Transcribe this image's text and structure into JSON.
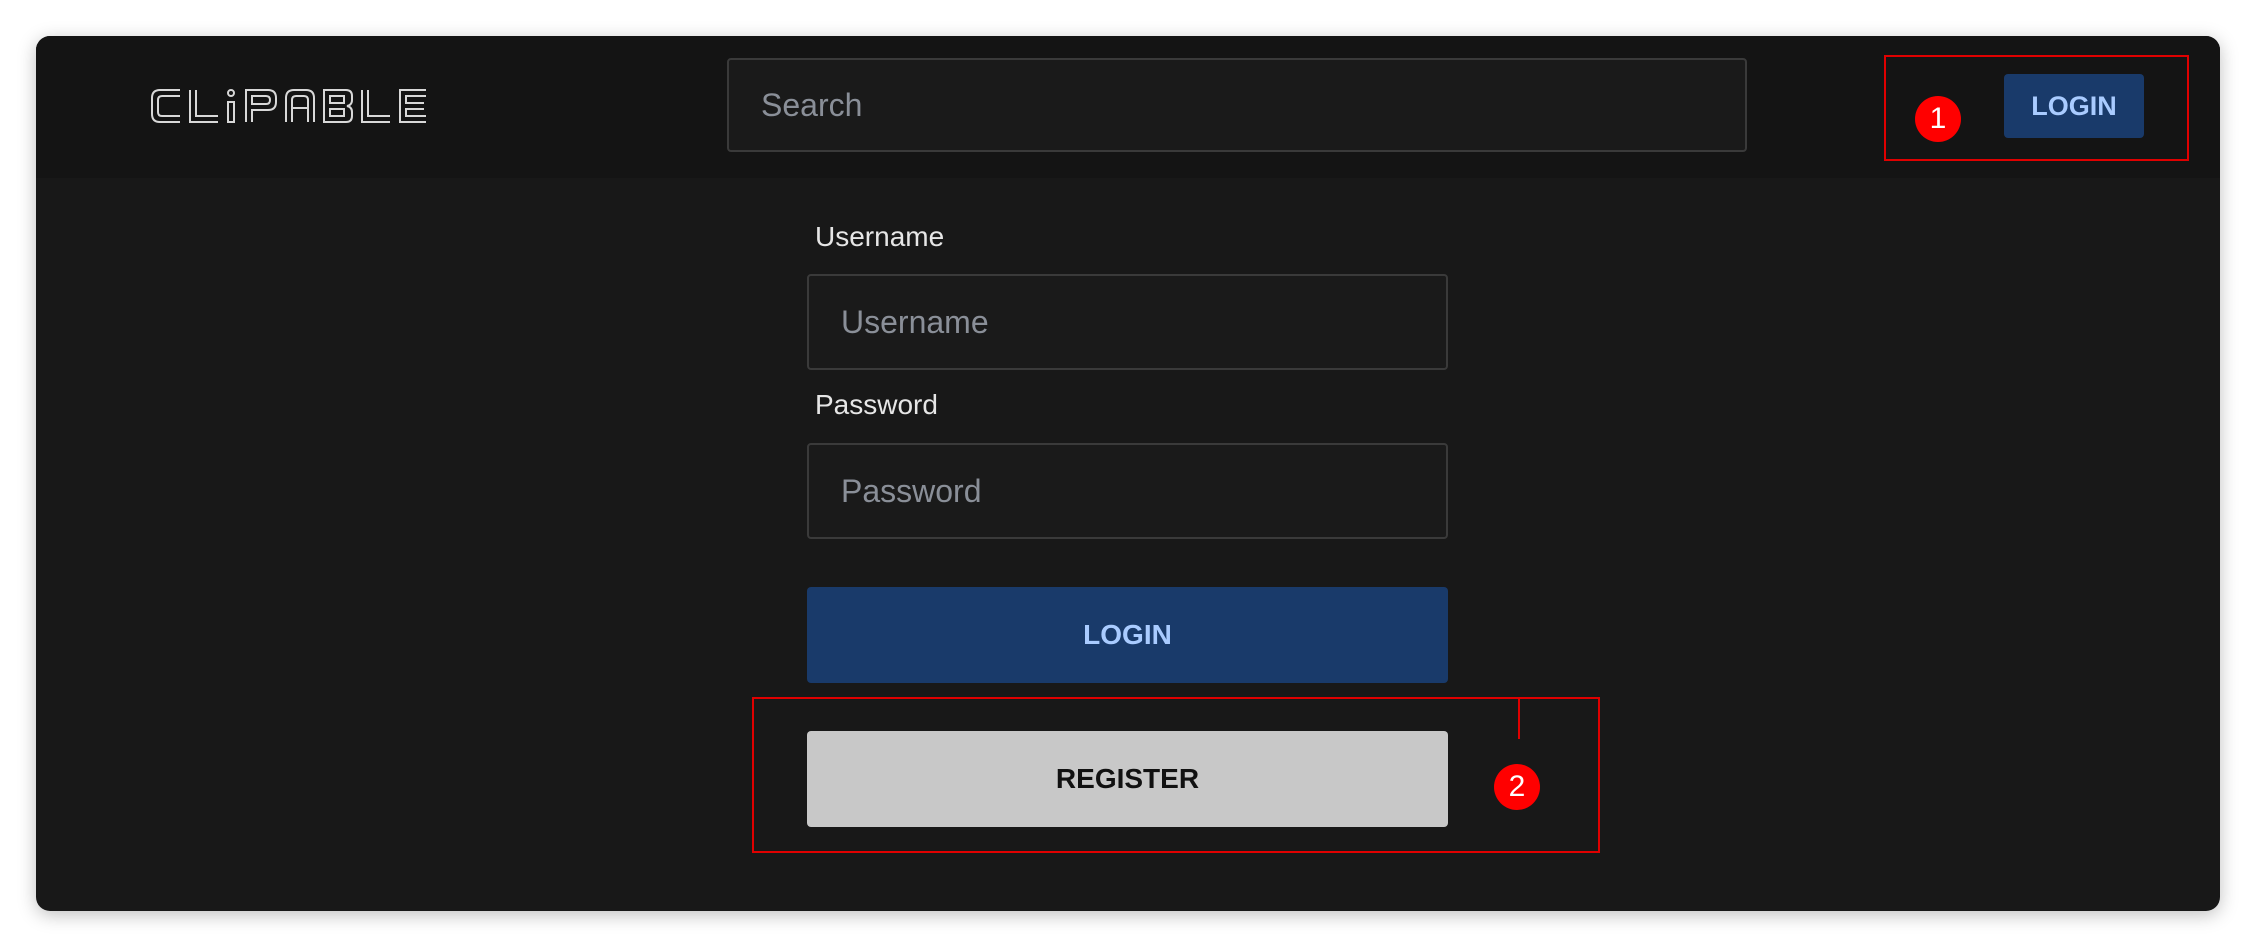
{
  "app": {
    "brand": "CLiPABLE"
  },
  "header": {
    "search_placeholder": "Search",
    "login_label": "LOGIN"
  },
  "form": {
    "username_label": "Username",
    "username_placeholder": "Username",
    "password_label": "Password",
    "password_placeholder": "Password",
    "login_label": "LOGIN",
    "register_label": "REGISTER"
  },
  "annotations": [
    {
      "number": "1"
    },
    {
      "number": "2"
    }
  ],
  "colors": {
    "background": "#181818",
    "header_background": "#141414",
    "primary_button": "#193a6a",
    "primary_button_text": "#a9cbff",
    "secondary_button": "#c8c8c8",
    "annotation": "#ff0000"
  },
  "icons": {
    "logo": "clipable-logo"
  }
}
